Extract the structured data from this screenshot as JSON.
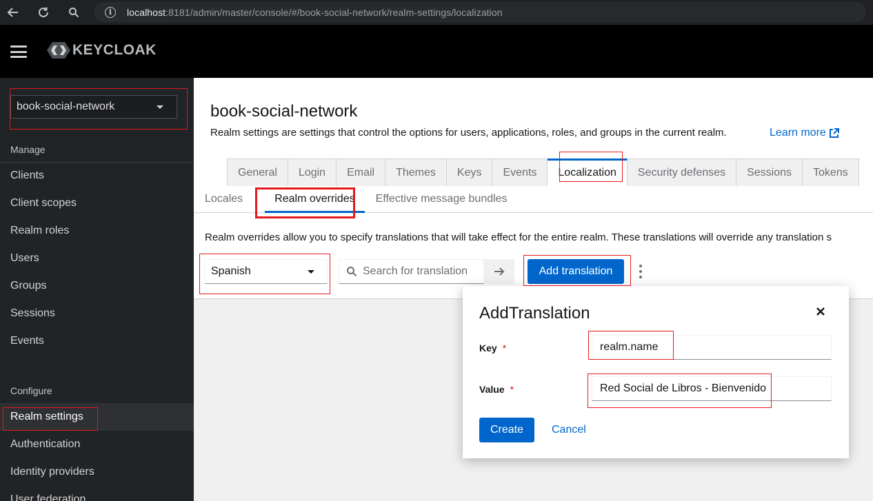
{
  "browser": {
    "url_host": "localhost",
    "url_rest": ":8181/admin/master/console/#/book-social-network/realm-settings/localization"
  },
  "header": {
    "logo_text": "KEYCLOAK"
  },
  "sidebar": {
    "realm_selector": "book-social-network",
    "manage_title": "Manage",
    "manage_items": [
      "Clients",
      "Client scopes",
      "Realm roles",
      "Users",
      "Groups",
      "Sessions",
      "Events"
    ],
    "configure_title": "Configure",
    "configure_items": [
      "Realm settings",
      "Authentication",
      "Identity providers",
      "User federation"
    ],
    "active_item": "Realm settings"
  },
  "main": {
    "title": "book-social-network",
    "description": "Realm settings are settings that control the options for users, applications, roles, and groups in the current realm.",
    "learn_more": "Learn more",
    "tabs": [
      "General",
      "Login",
      "Email",
      "Themes",
      "Keys",
      "Events",
      "Localization",
      "Security defenses",
      "Sessions",
      "Tokens"
    ],
    "active_tab": "Localization",
    "subtabs": [
      "Locales",
      "Realm overrides",
      "Effective message bundles"
    ],
    "active_subtab": "Realm overrides",
    "overrides_description": "Realm overrides allow you to specify translations that will take effect for the entire realm. These translations will override any translation s",
    "language_select": "Spanish",
    "search_placeholder": "Search for translation",
    "add_translation_label": "Add translation"
  },
  "modal": {
    "title": "AddTranslation",
    "key_label": "Key",
    "key_value": "realm.name",
    "value_label": "Value",
    "value_value": "Red Social de Libros - Bienvenido",
    "required_mark": "*",
    "create_label": "Create",
    "cancel_label": "Cancel"
  },
  "colors": {
    "primary": "#0066cc",
    "annotation": "#e3191b",
    "sidebar_bg": "#212427",
    "header_bg": "#000000"
  }
}
